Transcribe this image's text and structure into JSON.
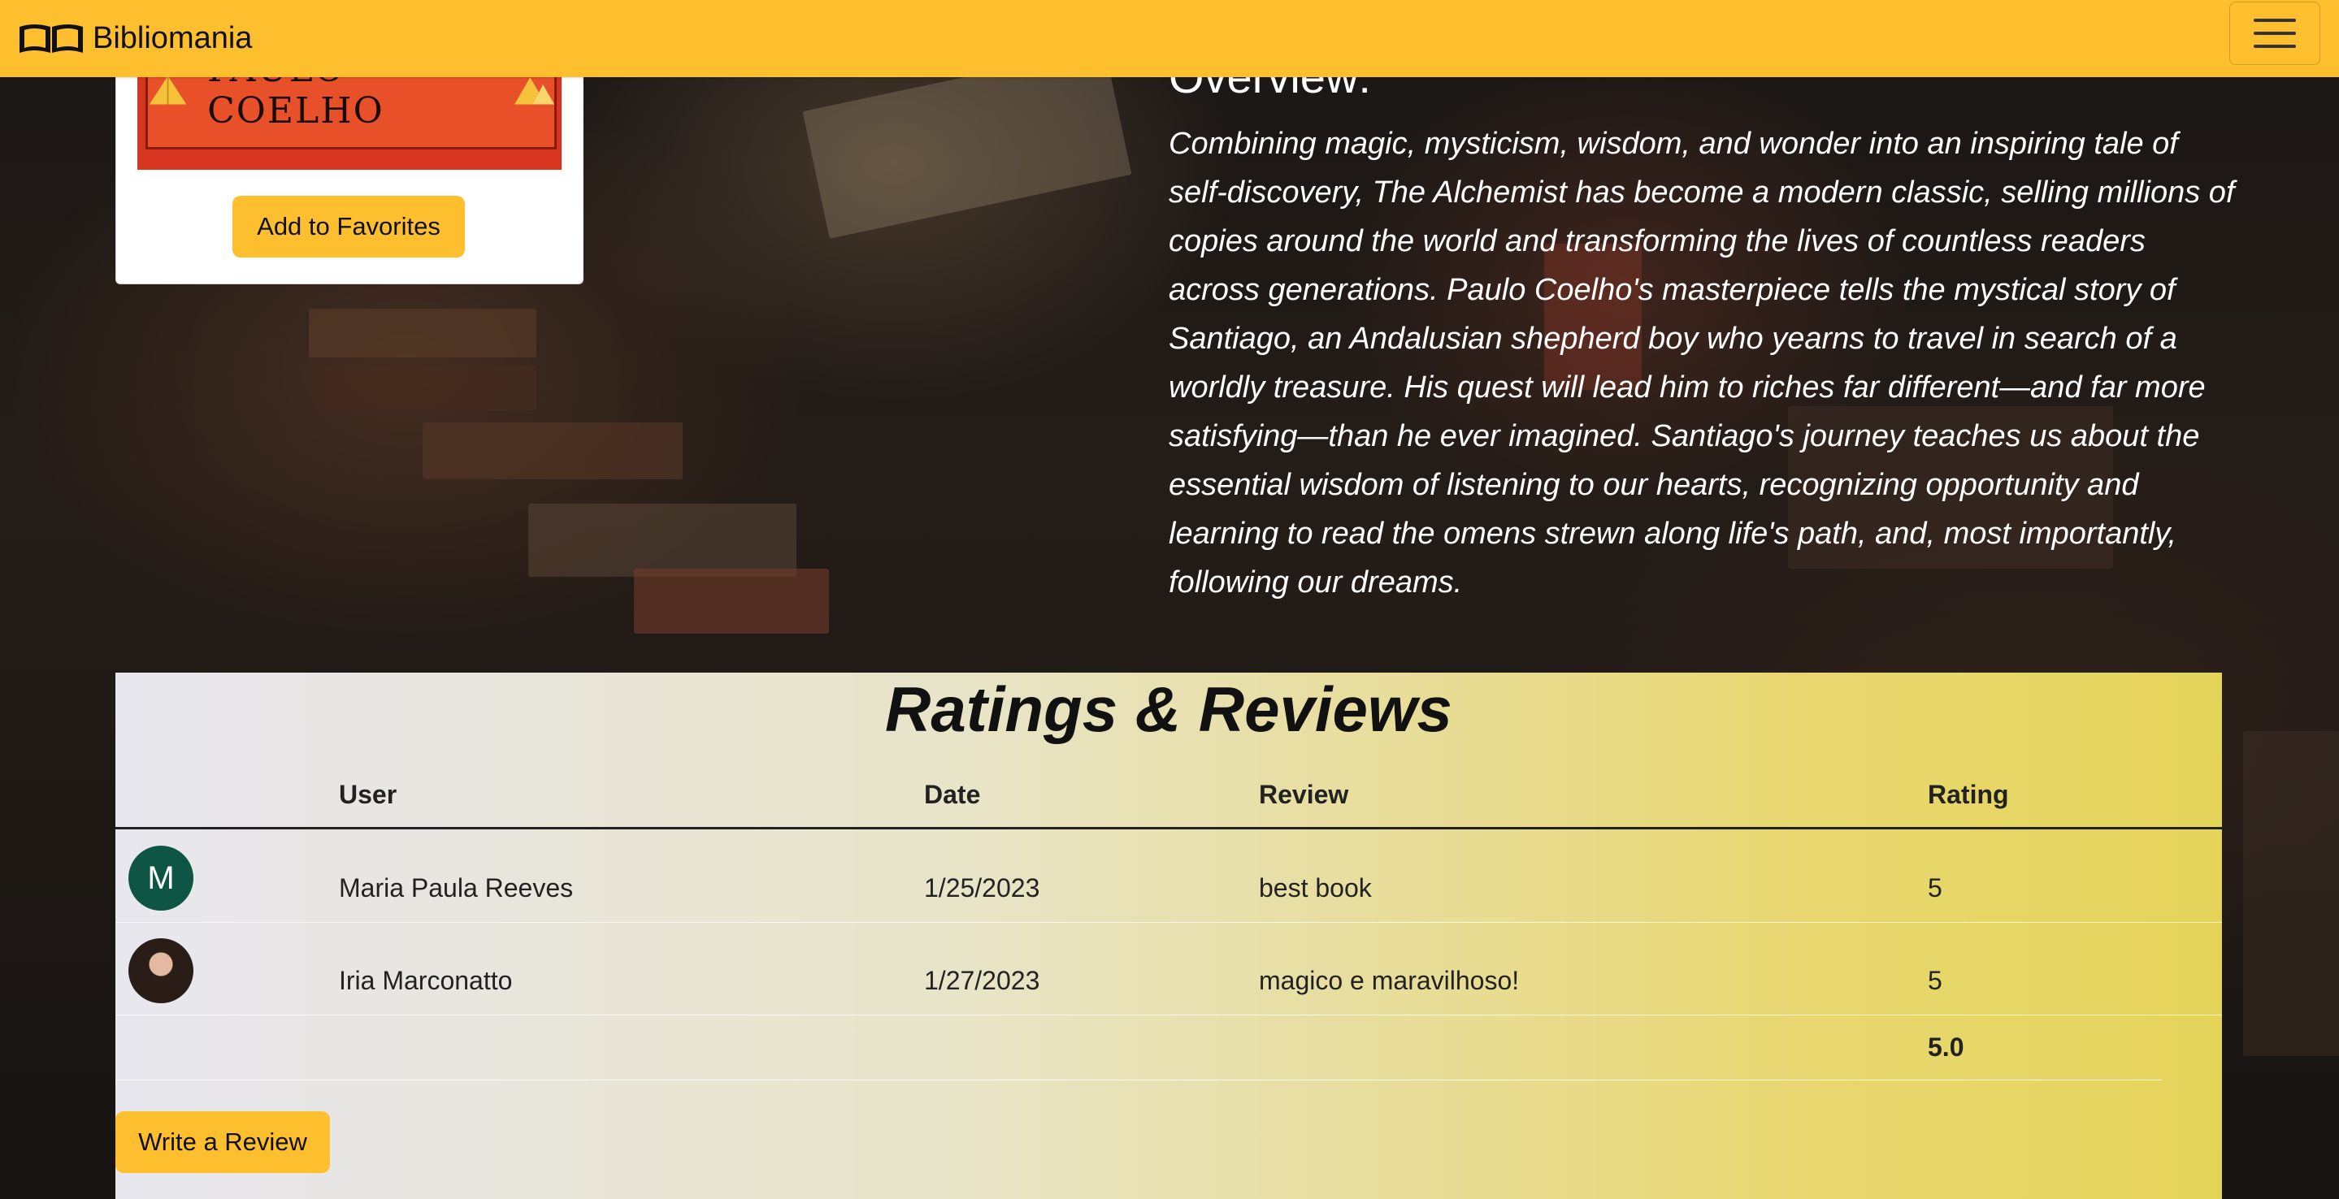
{
  "app": {
    "brand": "Bibliomania",
    "brand_icon": "open-book-icon",
    "menu_icon": "hamburger-icon"
  },
  "book": {
    "cover_author": "PAULO COELHO",
    "favorites_label": "Add to Favorites",
    "overview_heading": "Overview:",
    "overview": "Combining magic, mysticism, wisdom, and wonder into an inspiring tale of self-discovery, The Alchemist has become a modern classic, selling millions of copies around the world and transforming the lives of countless readers across generations. Paulo Coelho's masterpiece tells the mystical story of Santiago, an Andalusian shepherd boy who yearns to travel in search of a worldly treasure. His quest will lead him to riches far different—and far more satisfying—than he ever imagined. Santiago's journey teaches us about the essential wisdom of listening to our hearts, recognizing opportunity and learning to read the omens strewn along life's path, and, most importantly, following our dreams."
  },
  "reviews": {
    "title": "Ratings & Reviews",
    "columns": {
      "user": "User",
      "date": "Date",
      "review": "Review",
      "rating": "Rating"
    },
    "rows": [
      {
        "avatar_letter": "M",
        "user": "Maria Paula Reeves",
        "date": "1/25/2023",
        "review": "best book",
        "rating": "5"
      },
      {
        "avatar_letter": "",
        "user": "Iria Marconatto",
        "date": "1/27/2023",
        "review": "magico e maravilhoso!",
        "rating": "5"
      }
    ],
    "average": "5.0",
    "write_label": "Write a Review"
  },
  "colors": {
    "accent": "#fdbf2d",
    "avatar_m": "#0e5545"
  }
}
